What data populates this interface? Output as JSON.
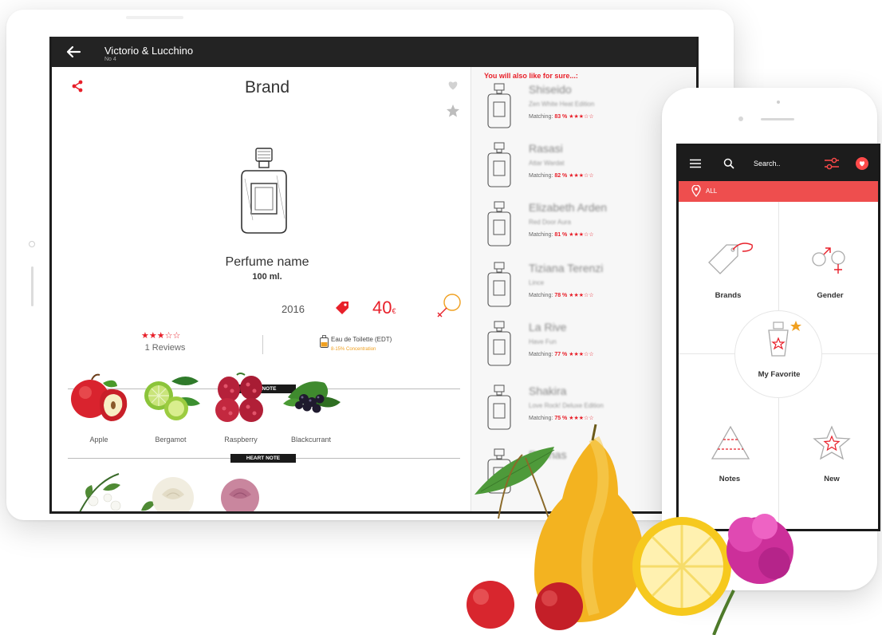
{
  "tablet": {
    "header": {
      "title": "Victorio & Lucchino",
      "subtitle": "No 4"
    },
    "product": {
      "brand": "Brand",
      "name": "Perfume name",
      "size": "100 ml.",
      "year": "2016",
      "price": "40",
      "currency": "€",
      "rating": "★★★☆☆",
      "reviews": "1 Reviews",
      "concentration": "Eau de Toilette (EDT)",
      "concentration_pct": "8-15% Concentration"
    },
    "sections": {
      "top": "TOP NOTE",
      "heart": "HEART NOTE"
    },
    "top_notes": [
      {
        "name": "Apple"
      },
      {
        "name": "Bergamot"
      },
      {
        "name": "Raspberry"
      },
      {
        "name": "Blackcurrant"
      }
    ],
    "recommendations": {
      "title": "You will also like for sure...:",
      "matching_label": "Matching:",
      "items": [
        {
          "name": "Shiseido",
          "edition": "Zen White Heat Edition",
          "match": "83 %",
          "stars": "★★★☆☆"
        },
        {
          "name": "Rasasi",
          "edition": "Attar Wardat",
          "match": "82 %",
          "stars": "★★★☆☆"
        },
        {
          "name": "Elizabeth Arden",
          "edition": "Red Door Aura",
          "match": "81 %",
          "stars": "★★★☆☆"
        },
        {
          "name": "Tiziana Terenzi",
          "edition": "Lince",
          "match": "78 %",
          "stars": "★★★☆☆"
        },
        {
          "name": "La Rive",
          "edition": "Have Fun",
          "match": "77 %",
          "stars": "★★★☆☆"
        },
        {
          "name": "Shakira",
          "edition": "Love Rock! Deluxe Edition",
          "match": "75 %",
          "stars": "★★★☆☆"
        },
        {
          "name": "Rochas",
          "edition": "",
          "match": "",
          "stars": ""
        }
      ]
    }
  },
  "phone": {
    "search_placeholder": "Search..",
    "location": "ALL",
    "menu": {
      "brands": "Brands",
      "gender": "Gender",
      "favorite": "My Favorite",
      "notes": "Notes",
      "new": "New"
    }
  },
  "colors": {
    "accent": "#e8202a",
    "location_bar": "#ee4e4e",
    "dark": "#1c1c1c"
  }
}
